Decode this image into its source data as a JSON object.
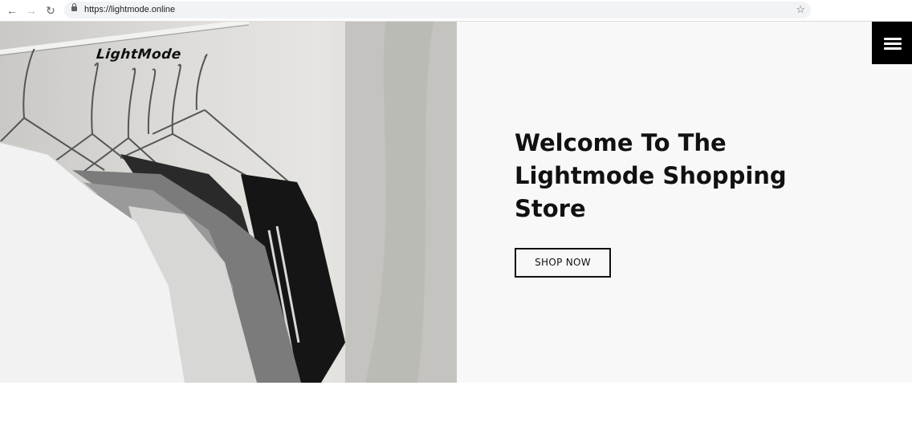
{
  "browser": {
    "url": "https://lightmode.online",
    "back_icon": "←",
    "forward_icon": "→",
    "reload_icon": "↻",
    "star_icon": "☆"
  },
  "site": {
    "logo_text": "LightMode"
  },
  "hero": {
    "title": "Welcome To The Lightmode Shopping Store",
    "cta_label": "SHOP NOW"
  },
  "colors": {
    "panel_bg": "#f8f8f8",
    "accent": "#000000"
  }
}
